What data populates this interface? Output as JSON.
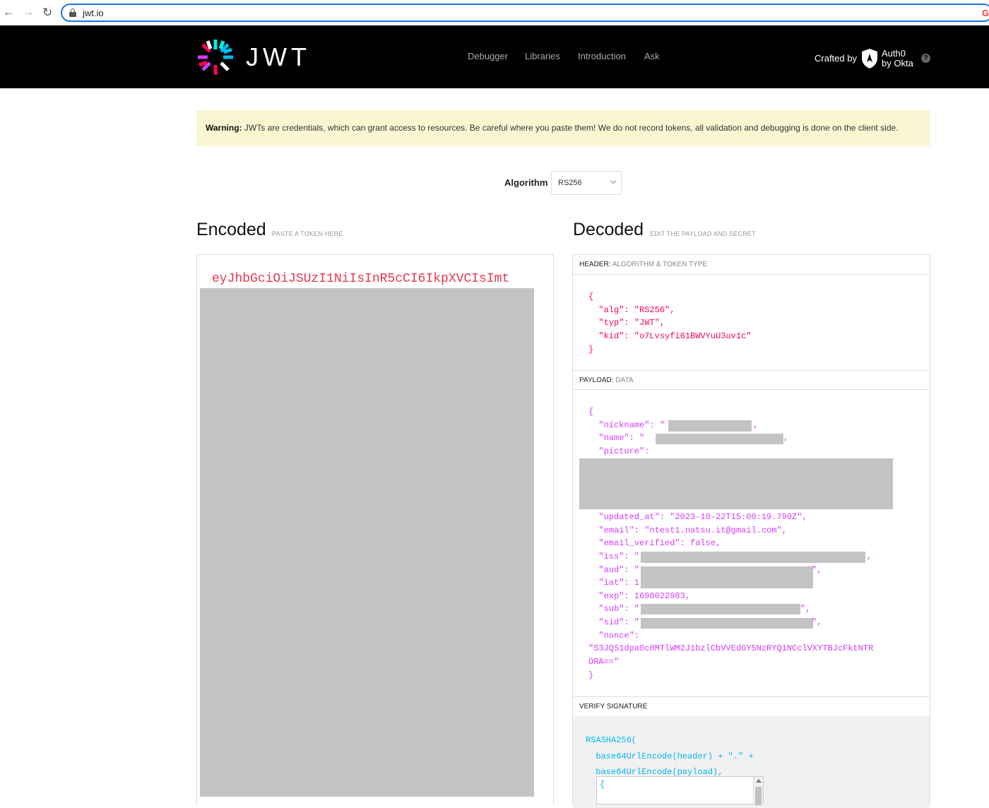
{
  "browser": {
    "back_icon": "arrow-left-icon",
    "forward_icon": "arrow-right-icon",
    "reload_icon": "reload-icon",
    "url": "jwt.io"
  },
  "header": {
    "logo_text": "JWT",
    "nav": [
      "Debugger",
      "Libraries",
      "Introduction",
      "Ask"
    ],
    "crafted_by": "Crafted by",
    "auth0_line1": "Auth0",
    "auth0_line2": "by Okta",
    "help": "?"
  },
  "warning": {
    "label": "Warning:",
    "text": "JWTs are credentials, which can grant access to resources. Be careful where you paste them! We do not record tokens, all validation and debugging is done on the client side."
  },
  "algorithm": {
    "label": "Algorithm",
    "selected": "RS256"
  },
  "encoded": {
    "title": "Encoded",
    "subtitle": "PASTE A TOKEN HERE",
    "token_visible": "eyJhbGciOiJSUzI1NiIsInR5cCI6IkpXVCIsImt"
  },
  "decoded": {
    "title": "Decoded",
    "subtitle": "EDIT THE PAYLOAD AND SECRET",
    "header_section": {
      "label": "HEADER:",
      "sublabel": "ALGORITHM & TOKEN TYPE",
      "lines": [
        "{",
        "  \"alg\": \"RS256\",",
        "  \"typ\": \"JWT\",",
        "  \"kid\": \"o7Lvsyfi61BWVYuU3uv1c\"",
        "}"
      ]
    },
    "payload_section": {
      "label": "PAYLOAD:",
      "sublabel": "DATA",
      "line_open": "{",
      "nickname": "  \"nickname\": \"",
      "nickname_end": ",",
      "name": "  \"name\": \"",
      "name_end": ",",
      "picture": "  \"picture\":",
      "updated_at": "  \"updated_at\": \"2023-10-22T15:00:19.790Z\",",
      "email": "  \"email\": \"ntest1.natsu.it@gmail.com\",",
      "email_verified": "  \"email_verified\": false,",
      "iss": "  \"iss\": \"",
      "iss_end": ",",
      "aud": "  \"aud\": \"",
      "aud_end": "\",",
      "iat": "  \"iat\": 1",
      "exp": "  \"exp\": 1698022983,",
      "sub": "  \"sub\": \"",
      "sub_end": "\",",
      "sid": "  \"sid\": \"",
      "sid_end": "\",",
      "nonce": "  \"nonce\":",
      "nonce_val1": "\"S3JQS1dpa0c0MTlWM2J1bzlCbVVEdGY5NzRYQ1NCclVXYTBJcFktNTR",
      "nonce_val2": "ORA==\"",
      "line_close": "}"
    },
    "verify_section": {
      "label": "VERIFY SIGNATURE",
      "lines": [
        "RSASHA256(",
        "  base64UrlEncode(header) + \".\" +",
        "  base64UrlEncode(payload),"
      ],
      "secret_brace": "{"
    }
  },
  "colors": {
    "header_bg": "#000000",
    "warning_bg": "#fbf6d2",
    "token_red": "#e8364f",
    "header_code": "#fb015b",
    "payload_code": "#d63aff",
    "signature_code": "#00b9f1",
    "redaction": "#c3c3c3"
  }
}
